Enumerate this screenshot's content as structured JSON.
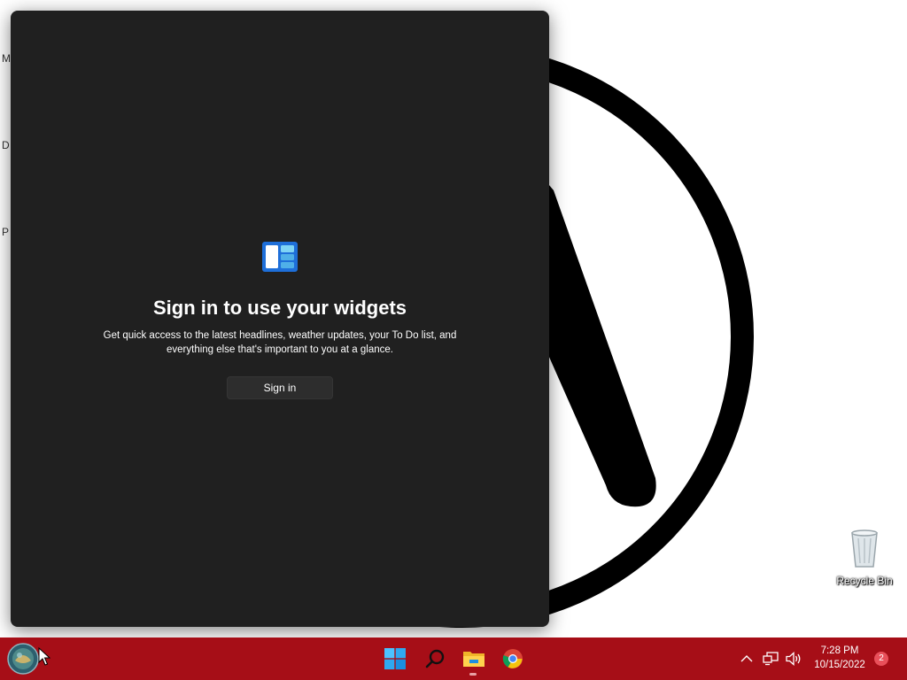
{
  "desktop": {
    "edge_letters": [
      "M",
      "D",
      "P"
    ],
    "recycle_bin_label": "Recycle Bin"
  },
  "widgets_panel": {
    "title": "Sign in to use your widgets",
    "description_line1": "Get quick access to the latest headlines, weather updates, your To Do list, and",
    "description_line2": "everything else that's important to you at a glance.",
    "signin_label": "Sign in"
  },
  "taskbar": {
    "icons": [
      "start-orb-icon",
      "windows-start-icon",
      "search-icon",
      "file-explorer-icon",
      "chrome-icon"
    ],
    "tray_icons": [
      "chevron-up-icon",
      "network-icon",
      "volume-icon"
    ],
    "time": "7:28 PM",
    "date": "10/15/2022",
    "notification_count": "2"
  },
  "colors": {
    "taskbar": "#a60e17",
    "panel": "#202020",
    "accent_blue": "#1e6fd9"
  }
}
